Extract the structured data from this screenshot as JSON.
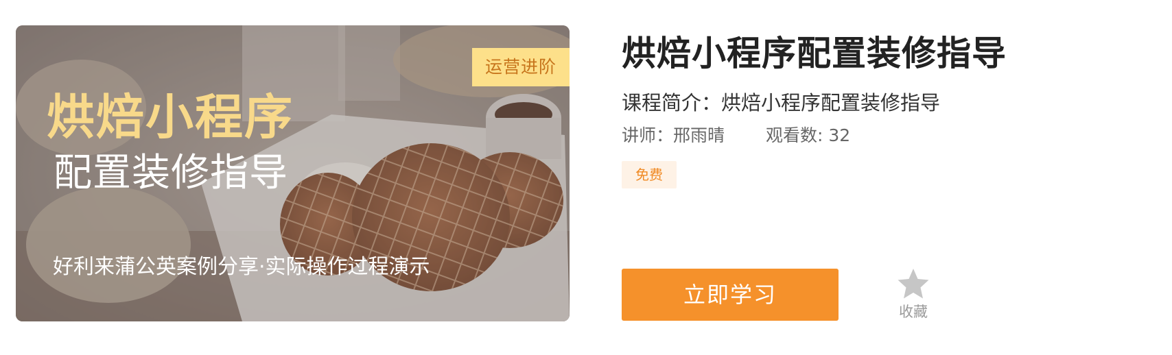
{
  "cover": {
    "tag": "运营进阶",
    "title_line1": "烘焙小程序",
    "title_line2": "配置装修指导",
    "subtitle": "好利来蒲公英案例分享·实际操作过程演示"
  },
  "course": {
    "title": "烘焙小程序配置装修指导",
    "intro_label": "课程简介：",
    "intro_text": "烘焙小程序配置装修指导",
    "lecturer_label": "讲师：",
    "lecturer_name": "邢雨晴",
    "views_label": "观看数: ",
    "views_count": "32",
    "price": "免费"
  },
  "actions": {
    "study_label": "立即学习",
    "favorite_label": "收藏",
    "favorite_icon": "star-icon"
  },
  "colors": {
    "accent": "#f5912b",
    "tag_bg": "#fde08a",
    "tag_text": "#c7751c",
    "cover_title": "#f8d98a",
    "badge_bg": "#fef2e6",
    "badge_text": "#f08a24"
  }
}
